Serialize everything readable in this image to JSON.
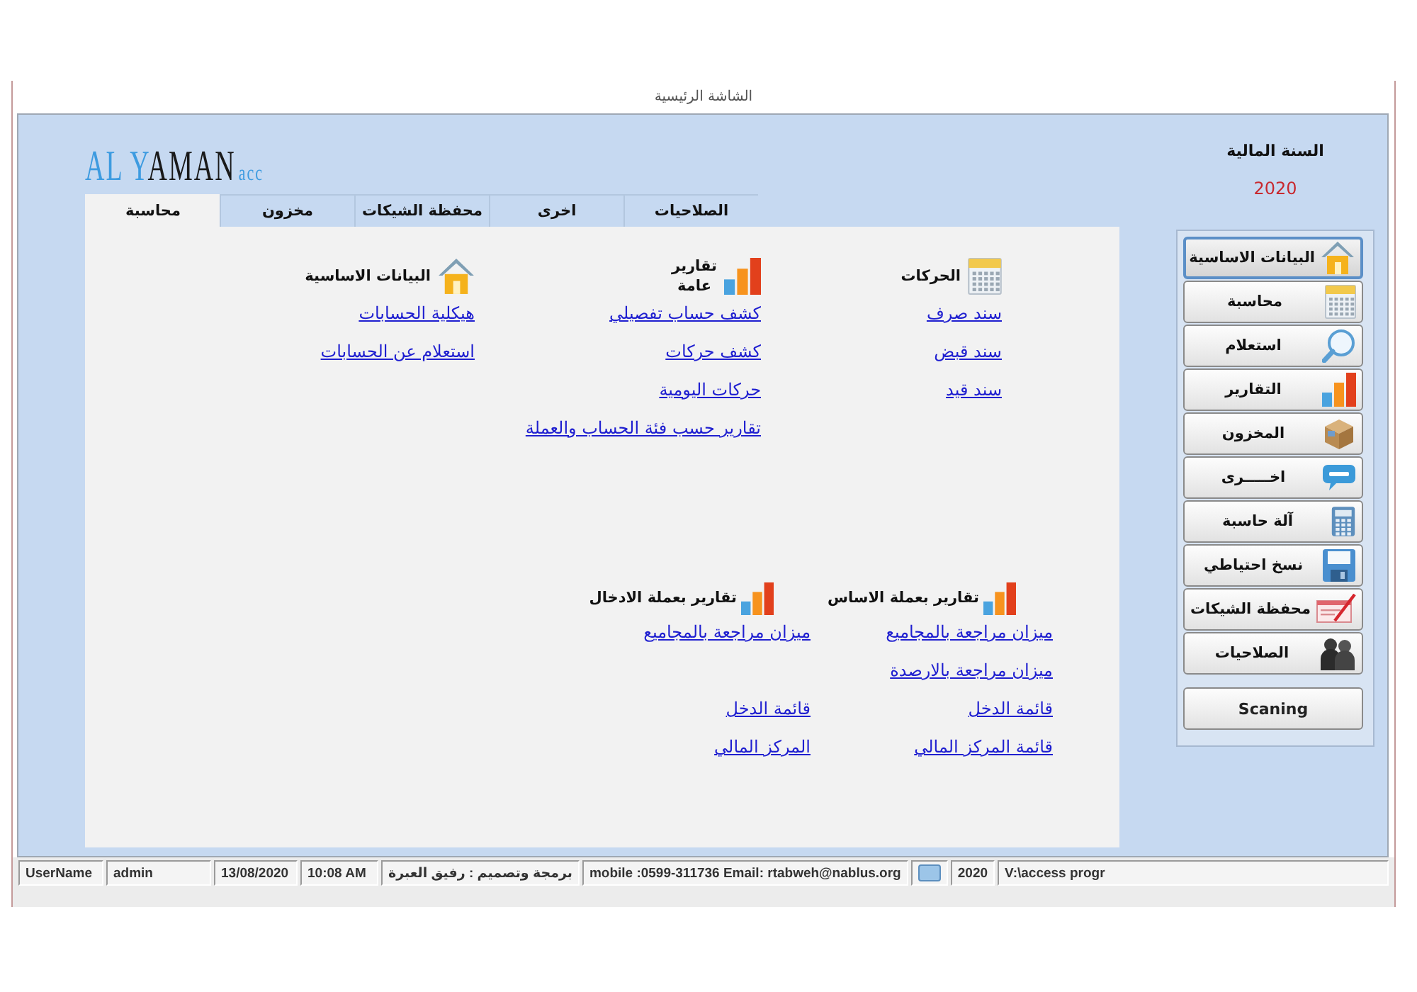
{
  "window": {
    "title": "الشاشة الرئيسية"
  },
  "logo": {
    "accent": "AL Y",
    "main": "AMAN",
    "suffix": "acc"
  },
  "tabs": [
    {
      "label": "الصلاحيات",
      "selected": false
    },
    {
      "label": "اخرى",
      "selected": false
    },
    {
      "label": "محفظة الشيكات",
      "selected": false
    },
    {
      "label": "مخزون",
      "selected": false
    },
    {
      "label": "محاسبة",
      "selected": true
    }
  ],
  "sections": [
    {
      "title": "الحركات",
      "links": [
        "سند صرف",
        "سند قبض",
        "سند قيد"
      ]
    },
    {
      "title": "تقارير عامة",
      "links": [
        "كشف حساب تفصيلي",
        "كشف حركات",
        "حركات اليومية",
        "تقارير حسب فئة الحساب والعملة"
      ]
    },
    {
      "title": "البيانات الاساسية",
      "links": [
        "هيكلية الحسابات",
        "استعلام عن الحسابات"
      ]
    }
  ],
  "report_sections": [
    {
      "title": "تقارير بعملة الاساس",
      "trial_balance_links": [
        "ميزان مراجعة بالمجاميع",
        "ميزان مراجعة بالارصدة"
      ],
      "statement_links": [
        "قائمة الدخل",
        "قائمة المركز المالي"
      ]
    },
    {
      "title": "تقارير بعملة الادخال",
      "trial_balance_links": [
        "ميزان مراجعة بالمجاميع"
      ],
      "statement_links": [
        "قائمة الدخل",
        "المركز المالي"
      ]
    }
  ],
  "fiscal_year": {
    "label": "السنة المالية",
    "value": "2020"
  },
  "sidebar": {
    "items": [
      {
        "label": "البيانات الاساسية",
        "selected": true
      },
      {
        "label": "محاسبة",
        "selected": false
      },
      {
        "label": "استعلام",
        "selected": false
      },
      {
        "label": "التقارير",
        "selected": false
      },
      {
        "label": "المخزون",
        "selected": false
      },
      {
        "label": "اخـــــرى",
        "selected": false
      },
      {
        "label": "آلة حاسبة",
        "selected": false
      },
      {
        "label": "نسخ احتياطي",
        "selected": false
      },
      {
        "label": "محفظة الشيكات",
        "selected": false
      },
      {
        "label": "الصلاحيات",
        "selected": false
      }
    ],
    "scan_button": {
      "label": "Scaning"
    }
  },
  "status_bar": {
    "cells": [
      {
        "kind": "text",
        "text": "V:\\access progr"
      },
      {
        "kind": "text",
        "text": "2020"
      },
      {
        "kind": "icon"
      },
      {
        "kind": "text",
        "text": "mobile :0599-311736 Email: rtabweh@nablus.org"
      },
      {
        "kind": "text",
        "text": "برمجة وتصميم : رفيق العبرة"
      },
      {
        "kind": "text",
        "text": "10:08 AM"
      },
      {
        "kind": "text",
        "text": "13/08/2020"
      },
      {
        "kind": "text",
        "text": "admin"
      },
      {
        "kind": "text",
        "text": "UserName"
      }
    ]
  }
}
